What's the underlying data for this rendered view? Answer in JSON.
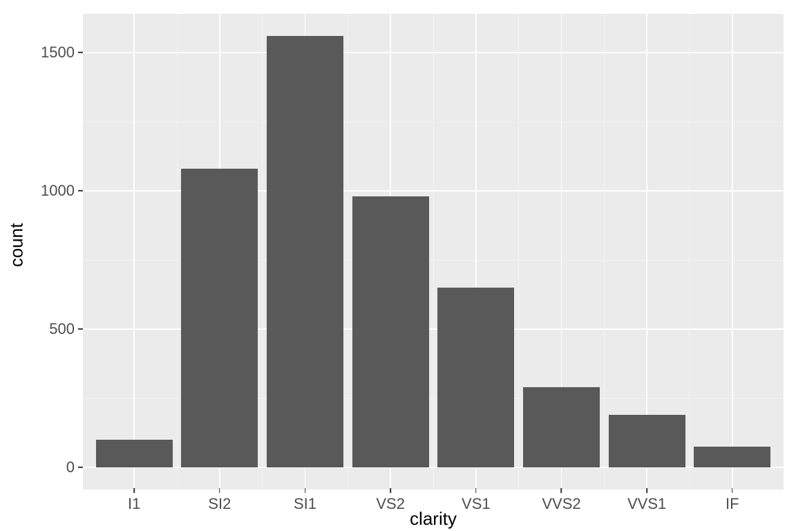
{
  "chart_data": {
    "type": "bar",
    "categories": [
      "I1",
      "SI2",
      "SI1",
      "VS2",
      "VS1",
      "VVS2",
      "VVS1",
      "IF"
    ],
    "values": [
      100,
      1080,
      1560,
      980,
      650,
      290,
      190,
      75
    ],
    "title": "",
    "xlabel": "clarity",
    "ylabel": "count",
    "ylim": [
      -80,
      1640
    ],
    "y_ticks": [
      0,
      500,
      1000,
      1500
    ],
    "y_minor_ticks": [
      250,
      750,
      1250
    ],
    "bar_color": "#595959",
    "panel_bg": "#ebebeb",
    "grid_major": "#ffffff"
  }
}
